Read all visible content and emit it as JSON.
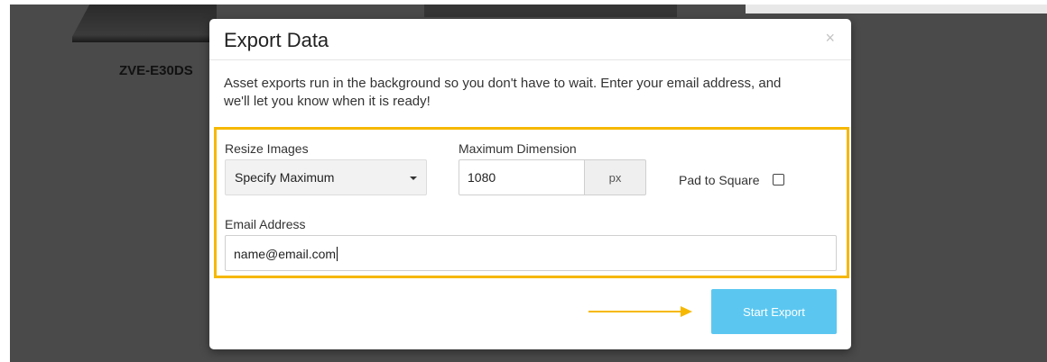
{
  "background": {
    "product_label": "ZVE-E30DS"
  },
  "modal": {
    "title": "Export Data",
    "close_glyph": "×",
    "intro_text": "Asset exports run in the background so you don't have to wait. Enter your email address, and we'll let you know when it is ready!",
    "resize": {
      "label": "Resize Images",
      "selected": "Specify Maximum"
    },
    "dimension": {
      "label": "Maximum Dimension",
      "value": "1080",
      "unit": "px"
    },
    "pad_to_square": {
      "label": "Pad to Square",
      "checked": false
    },
    "email": {
      "label": "Email Address",
      "value": "name@email.com"
    },
    "start_label": "Start Export"
  },
  "colors": {
    "highlight": "#f6b800",
    "button": "#5bc7f1"
  }
}
